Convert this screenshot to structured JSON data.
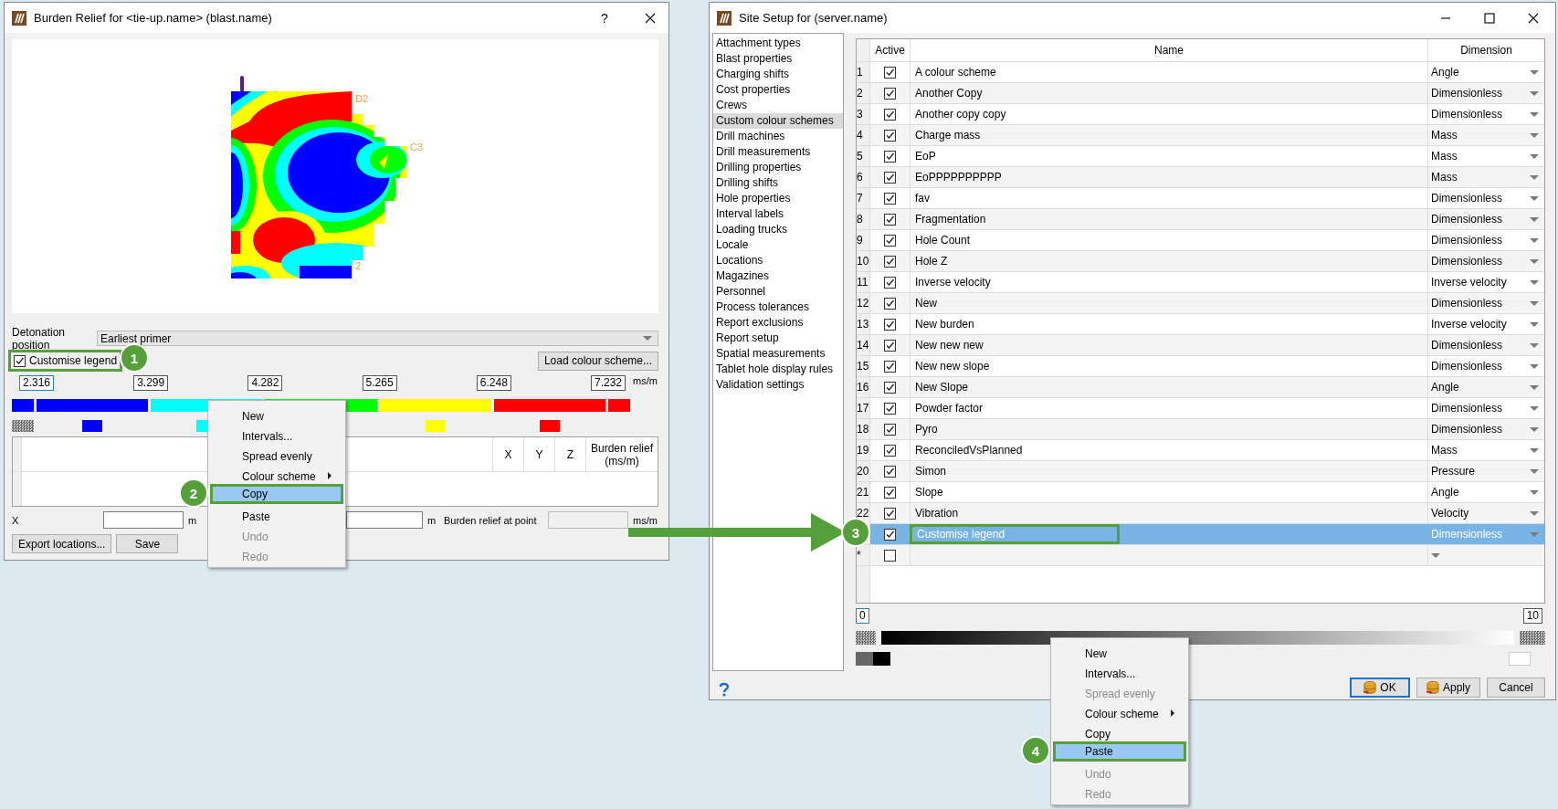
{
  "burden_window": {
    "title": "Burden Relief for <tie-up.name> (blast.name)",
    "help": "?",
    "map_labels": [
      "D2",
      "C3",
      "2"
    ],
    "detonation_position": {
      "label": "Detonation position",
      "value": "Earliest primer"
    },
    "customise_legend": {
      "label": "Customise legend",
      "checked": true,
      "highlighted": true
    },
    "load_button": "Load colour scheme...",
    "legend": {
      "ticks": [
        {
          "label": "2.316",
          "focused": true
        },
        {
          "label": "3.299",
          "focused": false
        },
        {
          "label": "4.282",
          "focused": false
        },
        {
          "label": "5.265",
          "focused": false
        },
        {
          "label": "6.248",
          "focused": false
        },
        {
          "label": "7.232",
          "focused": false
        }
      ],
      "unit": "ms/m",
      "segments": [
        {
          "color": "#0000ff",
          "swatch": true,
          "hatched": true
        },
        {
          "color": "#0000ff",
          "swatch": true,
          "hatched": false
        },
        {
          "color": "#00ffff",
          "swatch": true,
          "hatched": false
        },
        {
          "color": "#00ff00",
          "swatch": false
        },
        {
          "color": "#ffff00",
          "swatch": true,
          "hatched": false
        },
        {
          "color": "#ff0000",
          "swatch": true,
          "hatched": false
        },
        {
          "color": "#ff0000",
          "swatch": false
        }
      ]
    },
    "table": {
      "columns": [
        "X",
        "Y",
        "Z",
        "Burden relief (ms/m)"
      ]
    },
    "point_row": [
      {
        "kind": "label",
        "text": "X"
      },
      {
        "kind": "field",
        "disabled": false
      },
      {
        "kind": "unit",
        "text": "m"
      },
      {
        "kind": "field",
        "disabled": false
      },
      {
        "kind": "unit",
        "text": "m"
      },
      {
        "kind": "label",
        "text": "Burden relief at point"
      },
      {
        "kind": "field",
        "disabled": true
      },
      {
        "kind": "unit",
        "text": "ms/m"
      }
    ],
    "buttons": [
      "Export locations...",
      "Save"
    ]
  },
  "burden_menu": [
    {
      "label": "New",
      "disabled": false,
      "submenu": false,
      "selected": false
    },
    {
      "label": "Intervals...",
      "disabled": false,
      "submenu": false,
      "selected": false
    },
    {
      "label": "Spread evenly",
      "disabled": false,
      "submenu": false,
      "selected": false
    },
    {
      "label": "Colour scheme",
      "disabled": false,
      "submenu": true,
      "selected": false
    },
    {
      "label": "Copy",
      "disabled": false,
      "submenu": false,
      "selected": true
    },
    {
      "label": "Paste",
      "disabled": false,
      "submenu": false,
      "selected": false
    },
    {
      "label": "Undo",
      "disabled": true,
      "submenu": false,
      "selected": false
    },
    {
      "label": "Redo",
      "disabled": true,
      "submenu": false,
      "selected": false
    }
  ],
  "site_window": {
    "title": "Site Setup for (server.name)",
    "sidebar": [
      {
        "label": "Attachment types",
        "selected": false
      },
      {
        "label": "Blast properties",
        "selected": false
      },
      {
        "label": "Charging shifts",
        "selected": false
      },
      {
        "label": "Cost properties",
        "selected": false
      },
      {
        "label": "Crews",
        "selected": false
      },
      {
        "label": "Custom colour schemes",
        "selected": true
      },
      {
        "label": "Drill machines",
        "selected": false
      },
      {
        "label": "Drill measurements",
        "selected": false
      },
      {
        "label": "Drilling properties",
        "selected": false
      },
      {
        "label": "Drilling shifts",
        "selected": false
      },
      {
        "label": "Hole properties",
        "selected": false
      },
      {
        "label": "Interval labels",
        "selected": false
      },
      {
        "label": "Loading trucks",
        "selected": false
      },
      {
        "label": "Locale",
        "selected": false
      },
      {
        "label": "Locations",
        "selected": false
      },
      {
        "label": "Magazines",
        "selected": false
      },
      {
        "label": "Personnel",
        "selected": false
      },
      {
        "label": "Process tolerances",
        "selected": false
      },
      {
        "label": "Report exclusions",
        "selected": false
      },
      {
        "label": "Report setup",
        "selected": false
      },
      {
        "label": "Spatial measurements",
        "selected": false
      },
      {
        "label": "Tablet hole display rules",
        "selected": false
      },
      {
        "label": "Validation settings",
        "selected": false
      }
    ],
    "table": {
      "columns": [
        "Active",
        "Name",
        "Dimension"
      ],
      "rows": [
        {
          "index": "1",
          "active": true,
          "name": "A colour scheme",
          "dimension": "Angle",
          "selected": false
        },
        {
          "index": "2",
          "active": true,
          "name": "Another Copy",
          "dimension": "Dimensionless",
          "selected": false
        },
        {
          "index": "3",
          "active": true,
          "name": "Another copy copy",
          "dimension": "Dimensionless",
          "selected": false
        },
        {
          "index": "4",
          "active": true,
          "name": "Charge mass",
          "dimension": "Mass",
          "selected": false
        },
        {
          "index": "5",
          "active": true,
          "name": "EoP",
          "dimension": "Mass",
          "selected": false
        },
        {
          "index": "6",
          "active": true,
          "name": "EoPPPPPPPPPP",
          "dimension": "Mass",
          "selected": false
        },
        {
          "index": "7",
          "active": true,
          "name": "fav",
          "dimension": "Dimensionless",
          "selected": false
        },
        {
          "index": "8",
          "active": true,
          "name": "Fragmentation",
          "dimension": "Dimensionless",
          "selected": false
        },
        {
          "index": "9",
          "active": true,
          "name": "Hole Count",
          "dimension": "Dimensionless",
          "selected": false
        },
        {
          "index": "10",
          "active": true,
          "name": "Hole Z",
          "dimension": "Dimensionless",
          "selected": false
        },
        {
          "index": "11",
          "active": true,
          "name": "Inverse velocity",
          "dimension": "Inverse velocity",
          "selected": false
        },
        {
          "index": "12",
          "active": true,
          "name": "New",
          "dimension": "Dimensionless",
          "selected": false
        },
        {
          "index": "13",
          "active": true,
          "name": "New burden",
          "dimension": "Inverse velocity",
          "selected": false
        },
        {
          "index": "14",
          "active": true,
          "name": "New new new",
          "dimension": "Dimensionless",
          "selected": false
        },
        {
          "index": "15",
          "active": true,
          "name": "New new slope",
          "dimension": "Dimensionless",
          "selected": false
        },
        {
          "index": "16",
          "active": true,
          "name": "New Slope",
          "dimension": "Angle",
          "selected": false
        },
        {
          "index": "17",
          "active": true,
          "name": "Powder factor",
          "dimension": "Dimensionless",
          "selected": false
        },
        {
          "index": "18",
          "active": true,
          "name": "Pyro",
          "dimension": "Dimensionless",
          "selected": false
        },
        {
          "index": "19",
          "active": true,
          "name": "ReconciledVsPlanned",
          "dimension": "Mass",
          "selected": false
        },
        {
          "index": "20",
          "active": true,
          "name": "Simon",
          "dimension": "Pressure",
          "selected": false
        },
        {
          "index": "21",
          "active": true,
          "name": "Slope",
          "dimension": "Angle",
          "selected": false
        },
        {
          "index": "22",
          "active": true,
          "name": "Vibration",
          "dimension": "Velocity",
          "selected": false
        },
        {
          "active": true,
          "name": "Customise legend",
          "dimension": "Dimensionless",
          "selected": true
        },
        {
          "index": "*",
          "active": false,
          "selected": false
        }
      ]
    },
    "gradient_legend": {
      "ticks": [
        {
          "label": "0",
          "focused": true
        },
        {
          "label": "10",
          "focused": false
        }
      ]
    },
    "buttons": [
      {
        "label": "OK",
        "icon": true,
        "default": true
      },
      {
        "label": "Apply",
        "icon": true,
        "default": false
      },
      {
        "label": "Cancel",
        "icon": false,
        "default": false
      }
    ]
  },
  "site_menu": [
    {
      "label": "New",
      "disabled": false,
      "submenu": false,
      "selected": false
    },
    {
      "label": "Intervals...",
      "disabled": false,
      "submenu": false,
      "selected": false
    },
    {
      "label": "Spread evenly",
      "disabled": true,
      "submenu": false,
      "selected": false
    },
    {
      "label": "Colour scheme",
      "disabled": false,
      "submenu": true,
      "selected": false
    },
    {
      "label": "Copy",
      "disabled": false,
      "submenu": false,
      "selected": false
    },
    {
      "label": "Paste",
      "disabled": false,
      "submenu": false,
      "selected": true
    },
    {
      "label": "Undo",
      "disabled": true,
      "submenu": false,
      "selected": false
    },
    {
      "label": "Redo",
      "disabled": true,
      "submenu": false,
      "selected": false
    }
  ],
  "callouts": [
    "1",
    "2",
    "3",
    "4"
  ]
}
